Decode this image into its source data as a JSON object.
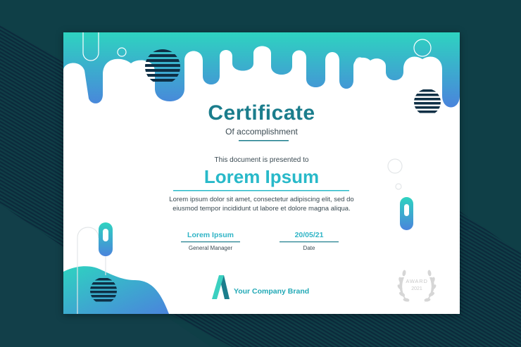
{
  "certificate": {
    "title": "Certificate",
    "subtitle": "Of accomplishment",
    "presented_text": "This document is presented to",
    "recipient_name": "Lorem Ipsum",
    "body": "Lorem ipsum dolor sit amet, consectetur adipiscing elit, sed do eiusmod tempor incididunt ut labore et dolore magna aliqua.",
    "signatures": [
      {
        "value": "Lorem Ipsum",
        "label": "General Manager"
      },
      {
        "value": "20/05/21",
        "label": "Date"
      }
    ],
    "brand": {
      "name": "Your Company Brand",
      "logo_icon": "letter-a-logo-icon"
    },
    "award": {
      "label": "AWARD",
      "year": "2021",
      "icon": "laurel-wreath-icon"
    }
  },
  "colors": {
    "background": "#0f3f47",
    "gradient_top": "#2ed3c0",
    "gradient_bottom": "#4a84dc",
    "title": "#1b7d8c",
    "accent": "#28b9c9",
    "stripes": "#0e2f45"
  }
}
